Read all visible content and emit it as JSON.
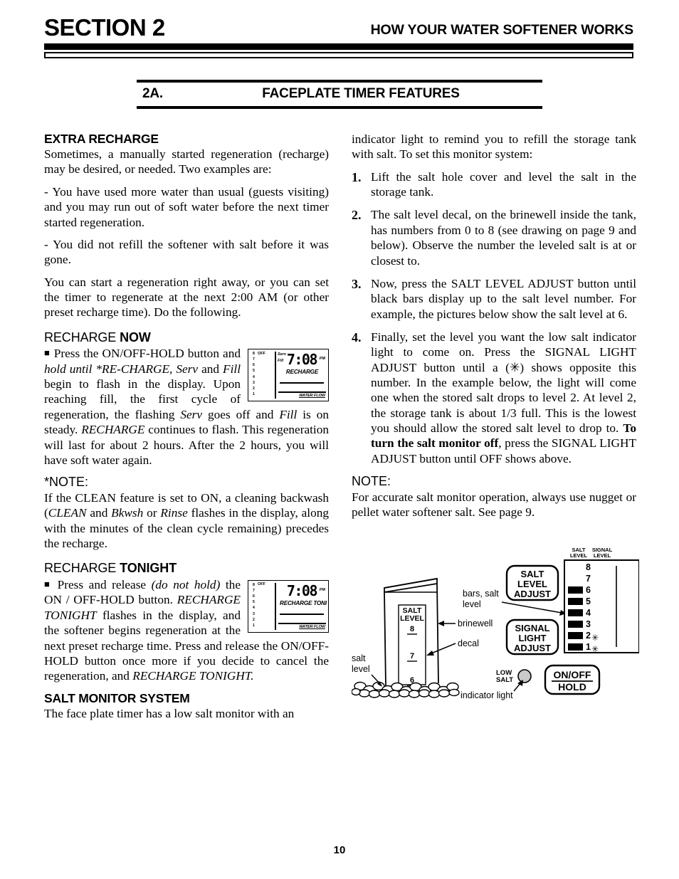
{
  "header": {
    "section_title": "SECTION 2",
    "subtitle": "HOW YOUR WATER SOFTENER WORKS"
  },
  "subsection": {
    "number": "2A.",
    "title": "FACEPLATE TIMER FEATURES"
  },
  "left_column": {
    "extra_recharge": {
      "heading": "EXTRA RECHARGE",
      "p1": "Sometimes, a manually started regeneration (recharge) may be desired, or needed. Two examples are:",
      "p2": "- You have used more water than usual (guests visiting) and you may run out of soft water before the next timer started regeneration.",
      "p3": "- You did not refill the softener with salt before it was gone.",
      "p4": "You can start a regeneration right away, or you can set the timer to regenerate at the next 2:00 AM (or other preset recharge time). Do the following."
    },
    "recharge_now": {
      "heading_plain": "RECHARGE ",
      "heading_bold": "NOW",
      "bullet": "■",
      "body_1": "Press the ON/OFF-HOLD button and ",
      "body_hold": "hold",
      "body_2": " until *RE-CHARGE, ",
      "body_serv": "Serv",
      "body_3": " and ",
      "body_fill": "Fill",
      "body_4": " begin to flash in the display. Upon reaching fill, the first cycle of regeneration, the flashing ",
      "body_serv2": "Serv",
      "body_5": " goes off and ",
      "body_fill2": "Fill",
      "body_6": " is on steady. ",
      "body_recharge": "RECHARGE",
      "body_7": " continues to flash. This regeneration will last for about 2 hours. After the 2 hours, you will have soft water again."
    },
    "note": {
      "heading": "*NOTE:",
      "body_1": "If the CLEAN feature is set to ON, a cleaning backwash (",
      "body_clean": "CLEAN",
      "body_2": " and ",
      "body_bkwsh": "Bkwsh",
      "body_3": " or ",
      "body_rinse": "Rinse",
      "body_4": " flashes in the display, along with the minutes of the clean cycle remaining) precedes the recharge."
    },
    "recharge_tonight": {
      "heading_plain": "RECHARGE ",
      "heading_bold": "TONIGHT",
      "bullet": "■",
      "body_1": "Press and release ",
      "body_donothold": "(do not hold)",
      "body_2": " the ON / OFF-HOLD button. ",
      "body_rt": "RECHARGE TONIGHT",
      "body_3": " flashes in the display, and the softener begins regeneration at the next preset recharge time. Press and release the ON/OFF-HOLD button once more if you decide to cancel the regeneration, and ",
      "body_rt2": "RECHARGE TONIGHT.",
      "body_4": ""
    },
    "salt_monitor": {
      "heading": "SALT MONITOR SYSTEM",
      "body": "The face plate timer has a low salt monitor with an"
    }
  },
  "right_column": {
    "intro": "indicator light to remind you to refill the storage tank with salt. To set this monitor system:",
    "steps": [
      {
        "n": "1.",
        "text": "Lift the salt hole cover and level the salt in the storage tank."
      },
      {
        "n": "2.",
        "text": "The salt level decal, on the brinewell inside the tank, has numbers from 0 to 8 (see drawing on page 9 and below). Observe the number the leveled salt is at or closest to."
      },
      {
        "n": "3.",
        "text": "Now, press the SALT LEVEL ADJUST button until black bars display up to the salt level number. For example, the pictures below show the salt level at 6."
      }
    ],
    "step4": {
      "n": "4.",
      "part1": "Finally, set the level you want the low salt indicator light to come on. Press the SIGNAL LIGHT ADJUST button until a (",
      "asterisk": "✳",
      "part2": ") shows opposite this number. In the example below, the light will come one when the stored salt drops to level 2. At level 2, the storage tank is about 1/3 full. This is the lowest you should allow the stored salt level to drop to. ",
      "bold": "To turn the salt monitor off",
      "part3": ", press the SIGNAL LIGHT ADJUST button until OFF shows above."
    },
    "note": {
      "heading": "NOTE:",
      "body": "For accurate salt monitor operation, always use nugget or pellet water softener salt. See page 9."
    }
  },
  "lcd_now": {
    "scale": [
      "8",
      "7",
      "6",
      "5",
      "4",
      "3",
      "2",
      "1"
    ],
    "off_label": "OFF",
    "serv_label": "Serv",
    "fill_label": "Fill",
    "time": "7:08",
    "ampm": "PM",
    "message": "RECHARGE",
    "water_flow": "WATER FLOW"
  },
  "lcd_tonight": {
    "scale": [
      "8",
      "7",
      "6",
      "5",
      "4",
      "3",
      "2",
      "1"
    ],
    "off_label": "OFF",
    "serv_label": "",
    "fill_label": "",
    "time": "7:08",
    "ampm": "PM",
    "message": "RECHARGE TONIGHT",
    "water_flow": "WATER FLOW"
  },
  "diagram": {
    "labels": {
      "salt_level": "salt\nlevel",
      "salt_level_l1": "salt",
      "salt_level_l2": "level",
      "brinewell": "brinewell",
      "decal": "decal",
      "bars_salt_level_l1": "bars, salt",
      "bars_salt_level_l2": "level",
      "indicator_light": "indicator light",
      "low_salt_l1": "LOW",
      "low_salt_l2": "SALT"
    },
    "decal": {
      "title_l1": "SALT",
      "title_l2": "LEVEL",
      "marks": [
        "8",
        "7",
        "6"
      ]
    },
    "buttons": [
      {
        "id": "salt-level-adjust",
        "lines": [
          "SALT",
          "LEVEL",
          "ADJUST"
        ]
      },
      {
        "id": "signal-light-adjust",
        "lines": [
          "SIGNAL",
          "LIGHT",
          "ADJUST"
        ]
      },
      {
        "id": "on-off-hold",
        "lines": [
          "ON/OFF",
          "HOLD"
        ]
      }
    ],
    "panel": {
      "col1_l1": "SALT",
      "col1_l2": "LEVEL",
      "col2_l1": "SIGNAL",
      "col2_l2": "LEVEL",
      "rows": [
        {
          "num": "8",
          "bar": false,
          "star": false
        },
        {
          "num": "7",
          "bar": false,
          "star": false
        },
        {
          "num": "6",
          "bar": true,
          "star": false
        },
        {
          "num": "5",
          "bar": true,
          "star": false
        },
        {
          "num": "4",
          "bar": true,
          "star": false
        },
        {
          "num": "3",
          "bar": true,
          "star": false
        },
        {
          "num": "2",
          "bar": true,
          "star": true
        },
        {
          "num": "1",
          "bar": true,
          "star": true
        }
      ],
      "star_glyph": "✳"
    }
  },
  "footer": {
    "page_number": "10"
  },
  "colors": {
    "ink": "#000000",
    "paper": "#ffffff"
  }
}
